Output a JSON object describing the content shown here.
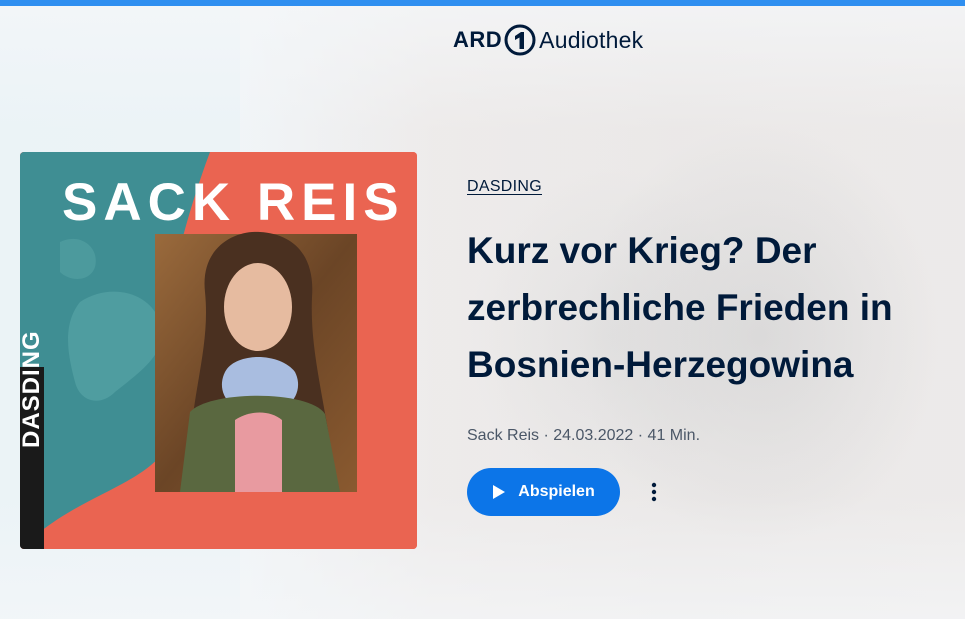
{
  "header": {
    "logo_ard": "ARD",
    "logo_audiothek": "Audiothek"
  },
  "cover": {
    "title": "SACK REIS",
    "brand": "DASDING"
  },
  "episode": {
    "channel": "DASDING",
    "title": "Kurz vor Krieg? Der zerbrechliche Frieden in Bosnien-Herzegowina",
    "meta": "Sack Reis · 24.03.2022 · 41 Min."
  },
  "actions": {
    "play_label": "Abspielen",
    "more_icon": "more-vertical-icon",
    "play_icon": "play-icon"
  },
  "colors": {
    "accent": "#0c75e8",
    "top_strip": "#2f8ff0",
    "text": "#001a3a",
    "cover_red": "#ea6451",
    "cover_teal": "#3f8e93"
  }
}
